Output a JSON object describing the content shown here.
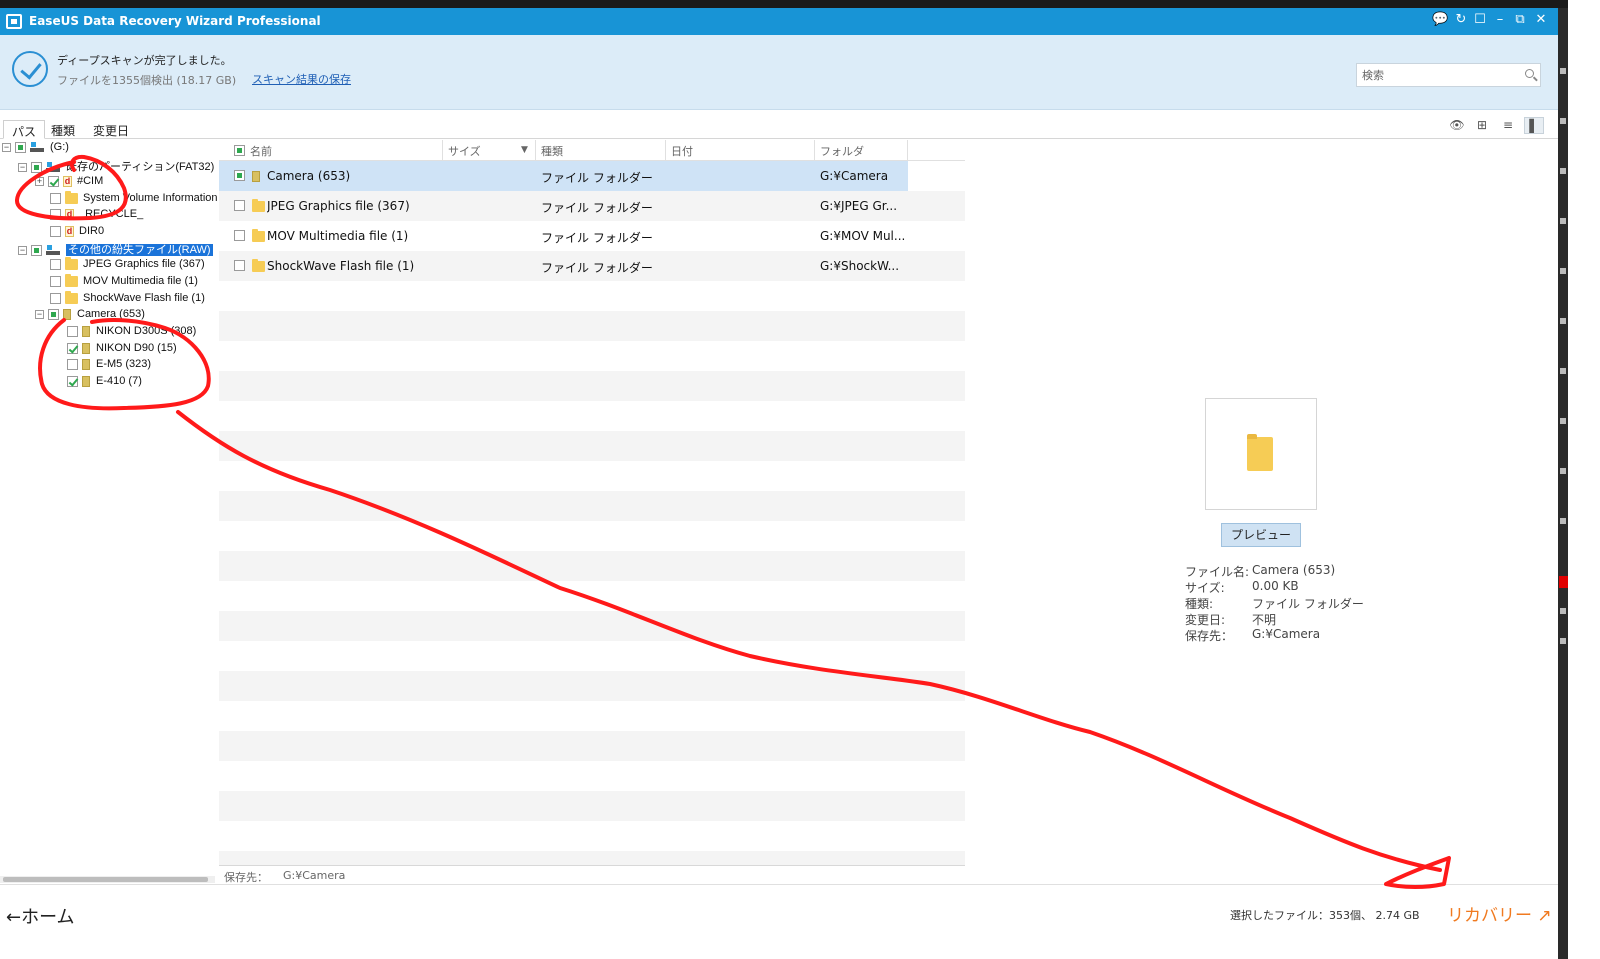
{
  "window": {
    "title": "EaseUS Data Recovery Wizard Professional",
    "controls": [
      "💬",
      "↻",
      "☐",
      "–",
      "⧉",
      "✕"
    ]
  },
  "header": {
    "status": "ディープスキャンが完了しました。",
    "found": "ファイルを1355個検出 (18.17 GB)",
    "save_link": "スキャン結果の保存",
    "search_placeholder": "検索"
  },
  "tabs": [
    "パス",
    "種類",
    "変更日"
  ],
  "view_buttons": [
    "👁",
    "⊞",
    "≡",
    "▌"
  ],
  "tree": [
    {
      "label": "(G:)",
      "icon": "drive",
      "exp": "-",
      "check": "partial"
    },
    {
      "label": "既存のパーティション(FAT32)",
      "icon": "drive",
      "exp": "-",
      "check": "partial"
    },
    {
      "label": "#CIM",
      "icon": "dfile",
      "exp": "+",
      "check": "checked"
    },
    {
      "label": "System Volume Information",
      "icon": "folder",
      "exp": "",
      "check": ""
    },
    {
      "label": "_RECYCLE_",
      "icon": "dfile",
      "exp": "",
      "check": ""
    },
    {
      "label": "DIR0",
      "icon": "dfile",
      "exp": "",
      "check": ""
    },
    {
      "label": "その他の紛失ファイル(RAW)",
      "icon": "drive",
      "exp": "-",
      "check": "partial",
      "selected": true
    },
    {
      "label": "JPEG Graphics file (367)",
      "icon": "folder",
      "exp": "",
      "check": ""
    },
    {
      "label": "MOV Multimedia file (1)",
      "icon": "folder",
      "exp": "",
      "check": ""
    },
    {
      "label": "ShockWave Flash file (1)",
      "icon": "folder",
      "exp": "",
      "check": ""
    },
    {
      "label": "Camera (653)",
      "icon": "camera",
      "exp": "-",
      "check": "partial"
    },
    {
      "label": "NIKON D300S (308)",
      "icon": "camera",
      "exp": "",
      "check": ""
    },
    {
      "label": "NIKON D90 (15)",
      "icon": "camera",
      "exp": "",
      "check": "checked"
    },
    {
      "label": "E-M5 (323)",
      "icon": "camera",
      "exp": "",
      "check": ""
    },
    {
      "label": "E-410 (7)",
      "icon": "camera",
      "exp": "",
      "check": "checked"
    }
  ],
  "columns": [
    "名前",
    "サイズ",
    "種類",
    "日付",
    "フォルダ"
  ],
  "rows": [
    {
      "name": "Camera (653)",
      "type": "ファイル フォルダー",
      "folder": "G:¥Camera",
      "icon": "camera",
      "check": "partial",
      "selected": true
    },
    {
      "name": "JPEG Graphics file (367)",
      "type": "ファイル フォルダー",
      "folder": "G:¥JPEG Gr...",
      "icon": "folder",
      "check": ""
    },
    {
      "name": "MOV Multimedia file (1)",
      "type": "ファイル フォルダー",
      "folder": "G:¥MOV Mul...",
      "icon": "folder",
      "check": ""
    },
    {
      "name": "ShockWave Flash file (1)",
      "type": "ファイル フォルダー",
      "folder": "G:¥ShockW...",
      "icon": "folder",
      "check": ""
    }
  ],
  "list_footer": {
    "label": "保存先：",
    "path": "G:¥Camera"
  },
  "preview": {
    "button": "プレビュー",
    "props": [
      {
        "k": "ファイル名:",
        "v": "Camera (653)"
      },
      {
        "k": "サイズ:",
        "v": "0.00 KB"
      },
      {
        "k": "種類:",
        "v": "ファイル フォルダー"
      },
      {
        "k": "変更日:",
        "v": "不明"
      },
      {
        "k": "保存先：",
        "v": "G:¥Camera"
      }
    ]
  },
  "bottom": {
    "home": "←ホーム",
    "selected": "選択したファイル：353個、 2.74 GB",
    "recover": "リカバリー ↗"
  },
  "colors": {
    "titlebar": "#1894d6",
    "header_bg": "#dcecf8",
    "accent": "#f07a20",
    "annotation": "#ff0000"
  }
}
